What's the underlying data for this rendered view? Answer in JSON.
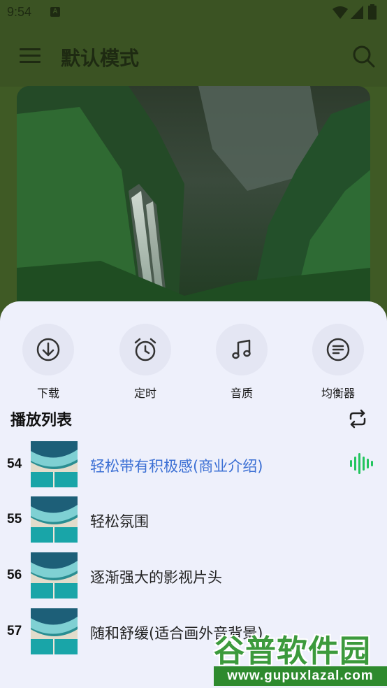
{
  "status_bar": {
    "time": "9:54",
    "badge": "A"
  },
  "app_bar": {
    "title": "默认模式"
  },
  "actions": [
    {
      "label": "下载",
      "icon": "download-icon"
    },
    {
      "label": "定时",
      "icon": "alarm-clock-icon"
    },
    {
      "label": "音质",
      "icon": "music-note-icon"
    },
    {
      "label": "均衡器",
      "icon": "equalizer-icon"
    }
  ],
  "playlist": {
    "title": "播放列表",
    "items": [
      {
        "number": "54",
        "name": "轻松带有积极感(商业介绍)",
        "playing": true
      },
      {
        "number": "55",
        "name": "轻松氛围"
      },
      {
        "number": "56",
        "name": "逐渐强大的影视片头"
      },
      {
        "number": "57",
        "name": "随和舒缓(适合画外音背景)"
      }
    ]
  },
  "watermark": {
    "title": "谷普软件园",
    "url": "www.gupuxlazal.com"
  },
  "colors": {
    "app_bar": "#3b5323",
    "sheet": "#eef0fb",
    "active_text": "#3b6fd4",
    "playing_icon": "#22c55e"
  }
}
